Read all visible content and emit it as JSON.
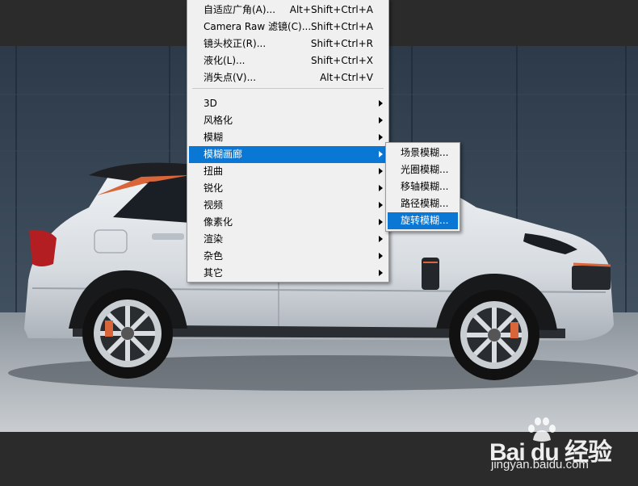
{
  "filter_menu": {
    "top_items": [
      {
        "label": "自适应广角(A)...",
        "shortcut": "Alt+Shift+Ctrl+A"
      },
      {
        "label": "Camera Raw 滤镜(C)...",
        "shortcut": "Shift+Ctrl+A"
      },
      {
        "label": "镜头校正(R)...",
        "shortcut": "Shift+Ctrl+R"
      },
      {
        "label": "液化(L)...",
        "shortcut": "Shift+Ctrl+X"
      },
      {
        "label": "消失点(V)...",
        "shortcut": "Alt+Ctrl+V"
      }
    ],
    "submenus": [
      {
        "label": "3D"
      },
      {
        "label": "风格化"
      },
      {
        "label": "模糊"
      },
      {
        "label": "模糊画廊",
        "highlighted": true
      },
      {
        "label": "扭曲"
      },
      {
        "label": "锐化"
      },
      {
        "label": "视频"
      },
      {
        "label": "像素化"
      },
      {
        "label": "渲染"
      },
      {
        "label": "杂色"
      },
      {
        "label": "其它"
      }
    ]
  },
  "blur_gallery_submenu": {
    "items": [
      {
        "label": "场景模糊..."
      },
      {
        "label": "光圈模糊..."
      },
      {
        "label": "移轴模糊..."
      },
      {
        "label": "路径模糊..."
      },
      {
        "label": "旋转模糊...",
        "highlighted": true
      }
    ]
  },
  "watermark": {
    "brand": "Bai du 经验",
    "url": "jingyan.baidu.com"
  },
  "colors": {
    "menu_bg": "#f0f0f0",
    "highlight": "#0a77d5",
    "workspace": "#2b2b2b"
  }
}
